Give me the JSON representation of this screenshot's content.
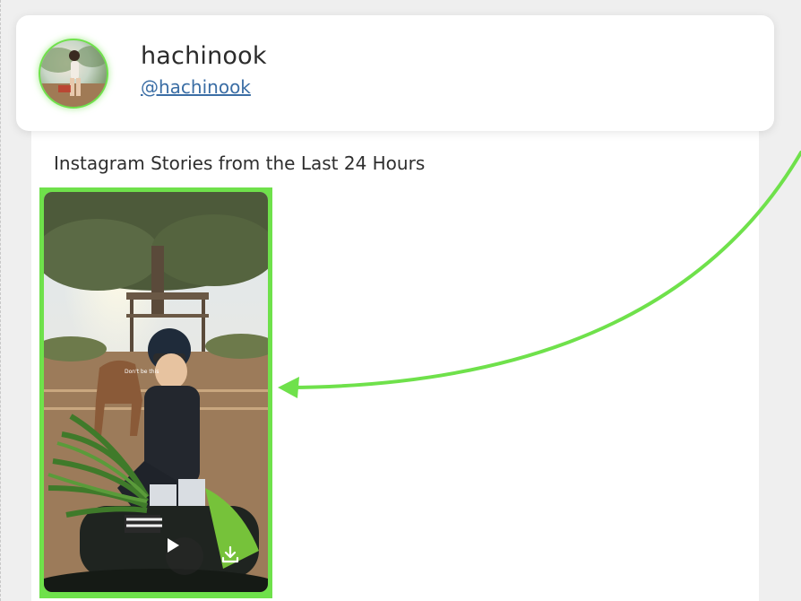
{
  "profile": {
    "username": "hachinook",
    "handle": "@hachinook"
  },
  "stories_section": {
    "title": "Instagram Stories from the Last 24 Hours",
    "stories": [
      {
        "caption": "Don't be this"
      }
    ]
  },
  "colors": {
    "highlight": "#6fe14b",
    "link": "#3b6ea5"
  },
  "icons": {
    "play": "play-icon",
    "download": "download-icon",
    "arrow": "pointer-arrow"
  }
}
